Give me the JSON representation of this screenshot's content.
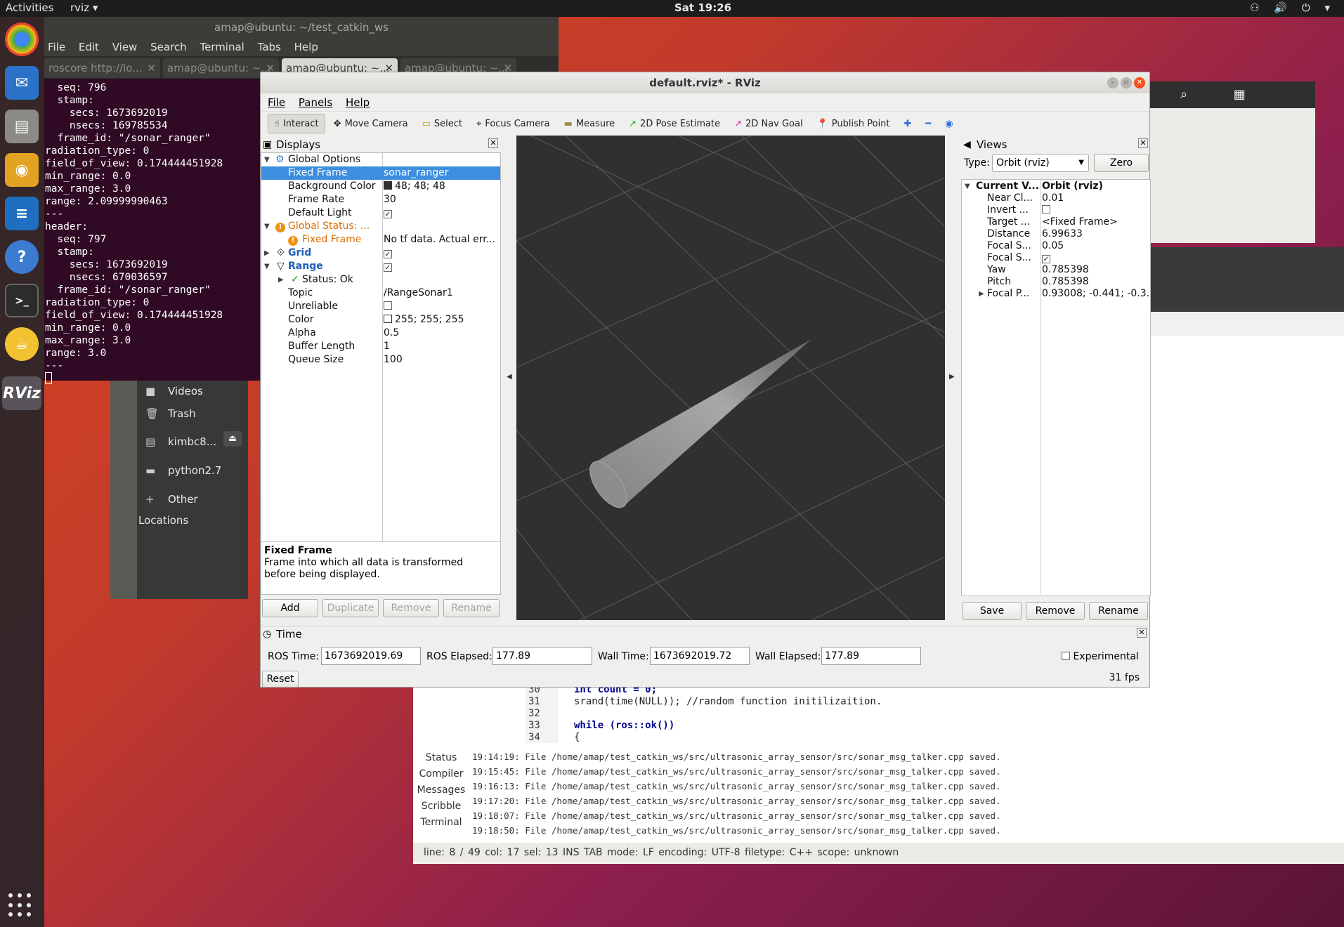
{
  "topbar": {
    "activities": "Activities",
    "app_menu": "rviz ▾",
    "clock": "Sat 19:26",
    "tray": "⚇ 🔊 ⏻ ▾"
  },
  "dock": {
    "icons": [
      "chrome-icon",
      "thunderbird-icon",
      "files-icon",
      "rhythmbox-icon",
      "writer-icon",
      "help-icon",
      "terminal-icon",
      "rostea-icon",
      "rviz-icon"
    ],
    "rviz_label": "RViz"
  },
  "terminal": {
    "title": "amap@ubuntu: ~/test_catkin_ws",
    "menu": [
      "File",
      "Edit",
      "View",
      "Search",
      "Terminal",
      "Tabs",
      "Help"
    ],
    "tabs": [
      "roscore http://lo...",
      "amap@ubuntu: ~...",
      "amap@ubuntu: ~...",
      "amap@ubuntu: ~..."
    ],
    "output": "  seq: 796\n  stamp:\n    secs: 1673692019\n    nsecs: 169785534\n  frame_id: \"/sonar_ranger\"\nradiation_type: 0\nfield_of_view: 0.174444451928\nmin_range: 0.0\nmax_range: 3.0\nrange: 2.09999990463\n---\nheader:\n  seq: 797\n  stamp:\n    secs: 1673692019\n    nsecs: 670036597\n  frame_id: \"/sonar_ranger\"\nradiation_type: 0\nfield_of_view: 0.174444451928\nmin_range: 0.0\nmax_range: 3.0\nrange: 3.0\n---"
  },
  "files": {
    "items": [
      {
        "icon": "■",
        "label": "Videos"
      },
      {
        "icon": "🗑",
        "label": "Trash"
      },
      {
        "icon": "▤",
        "label": "kimbc8..."
      },
      {
        "icon": "▬",
        "label": "python2.7"
      },
      {
        "icon": "+",
        "label": "Other Locations"
      }
    ]
  },
  "editor": {
    "lines": [
      {
        "num": "30",
        "code": "int count = 0;"
      },
      {
        "num": "31",
        "code": "srand(time(NULL)); //random function initilizaition."
      },
      {
        "num": "32",
        "code": ""
      },
      {
        "num": "33",
        "code": "while (ros::ok())"
      },
      {
        "num": "34",
        "code": "{"
      }
    ],
    "msg_tabs": [
      "Status",
      "Compiler",
      "Messages",
      "Scribble",
      "Terminal"
    ],
    "log": [
      "19:14:19: File /home/amap/test_catkin_ws/src/ultrasonic_array_sensor/src/sonar_msg_talker.cpp saved.",
      "19:15:45: File /home/amap/test_catkin_ws/src/ultrasonic_array_sensor/src/sonar_msg_talker.cpp saved.",
      "19:16:13: File /home/amap/test_catkin_ws/src/ultrasonic_array_sensor/src/sonar_msg_talker.cpp saved.",
      "19:17:20: File /home/amap/test_catkin_ws/src/ultrasonic_array_sensor/src/sonar_msg_talker.cpp saved.",
      "19:18:07: File /home/amap/test_catkin_ws/src/ultrasonic_array_sensor/src/sonar_msg_talker.cpp saved.",
      "19:18:50: File /home/amap/test_catkin_ws/src/ultrasonic_array_sensor/src/sonar_msg_talker.cpp saved."
    ],
    "status": "line: 8 / 49   col: 17     sel: 13  INS    TAB    mode: LF    encoding: UTF-8    filetype: C++    scope: unknown"
  },
  "rviz": {
    "title": "default.rviz* - RViz",
    "menu": [
      "File",
      "Panels",
      "Help"
    ],
    "tools": [
      {
        "icon": "☝",
        "label": "Interact",
        "active": true
      },
      {
        "icon": "✥",
        "label": "Move Camera"
      },
      {
        "icon": "▭",
        "label": "Select"
      },
      {
        "icon": "⌖",
        "label": "Focus Camera"
      },
      {
        "icon": "▬",
        "label": "Measure"
      },
      {
        "icon": "↗",
        "label": "2D Pose Estimate"
      },
      {
        "icon": "↗",
        "label": "2D Nav Goal"
      },
      {
        "icon": "📍",
        "label": "Publish Point"
      }
    ],
    "tool_extras": [
      "✚",
      "━",
      "◉"
    ],
    "displays": {
      "header": "Displays",
      "rows": [
        {
          "k": "Global Options",
          "v": ""
        },
        {
          "k": "Fixed Frame",
          "v": "sonar_ranger"
        },
        {
          "k": "Background Color",
          "v": "48; 48; 48"
        },
        {
          "k": "Frame Rate",
          "v": "30"
        },
        {
          "k": "Default Light",
          "v": "✓"
        },
        {
          "k": "Global Status: ...",
          "v": ""
        },
        {
          "k": "Fixed Frame",
          "v": "No tf data.  Actual err..."
        },
        {
          "k": "Grid",
          "v": "✓"
        },
        {
          "k": "Range",
          "v": "✓"
        },
        {
          "k": "Status: Ok",
          "v": ""
        },
        {
          "k": "Topic",
          "v": "/RangeSonar1"
        },
        {
          "k": "Unreliable",
          "v": ""
        },
        {
          "k": "Color",
          "v": "255; 255; 255"
        },
        {
          "k": "Alpha",
          "v": "0.5"
        },
        {
          "k": "Buffer Length",
          "v": "1"
        },
        {
          "k": "Queue Size",
          "v": "100"
        }
      ],
      "desc_title": "Fixed Frame",
      "desc_text": "Frame into which all data is transformed before being displayed.",
      "buttons": [
        "Add",
        "Duplicate",
        "Remove",
        "Rename"
      ]
    },
    "views": {
      "header": "Views",
      "type_label": "Type:",
      "type_value": "Orbit (rviz)",
      "zero": "Zero",
      "rows": [
        {
          "k": "Current V...",
          "v": "Orbit (rviz)"
        },
        {
          "k": "Near Cl...",
          "v": "0.01"
        },
        {
          "k": "Invert ...",
          "v": ""
        },
        {
          "k": "Target ...",
          "v": "<Fixed Frame>"
        },
        {
          "k": "Distance",
          "v": "6.99633"
        },
        {
          "k": "Focal S...",
          "v": "0.05"
        },
        {
          "k": "Focal S...",
          "v": "✓"
        },
        {
          "k": "Yaw",
          "v": "0.785398"
        },
        {
          "k": "Pitch",
          "v": "0.785398"
        },
        {
          "k": "Focal P...",
          "v": "0.93008; -0.441; -0.3..."
        }
      ],
      "buttons": [
        "Save",
        "Remove",
        "Rename"
      ]
    },
    "time": {
      "header": "Time",
      "ros_time_label": "ROS Time:",
      "ros_time": "1673692019.69",
      "ros_elapsed_label": "ROS Elapsed:",
      "ros_elapsed": "177.89",
      "wall_time_label": "Wall Time:",
      "wall_time": "1673692019.72",
      "wall_elapsed_label": "Wall Elapsed:",
      "wall_elapsed": "177.89",
      "experimental": "Experimental",
      "reset": "Reset",
      "fps": "31 fps"
    },
    "colors": {
      "background": "#303030",
      "selection": "#3d8ee0",
      "warning": "#f29111",
      "close": "#f4511e"
    }
  }
}
